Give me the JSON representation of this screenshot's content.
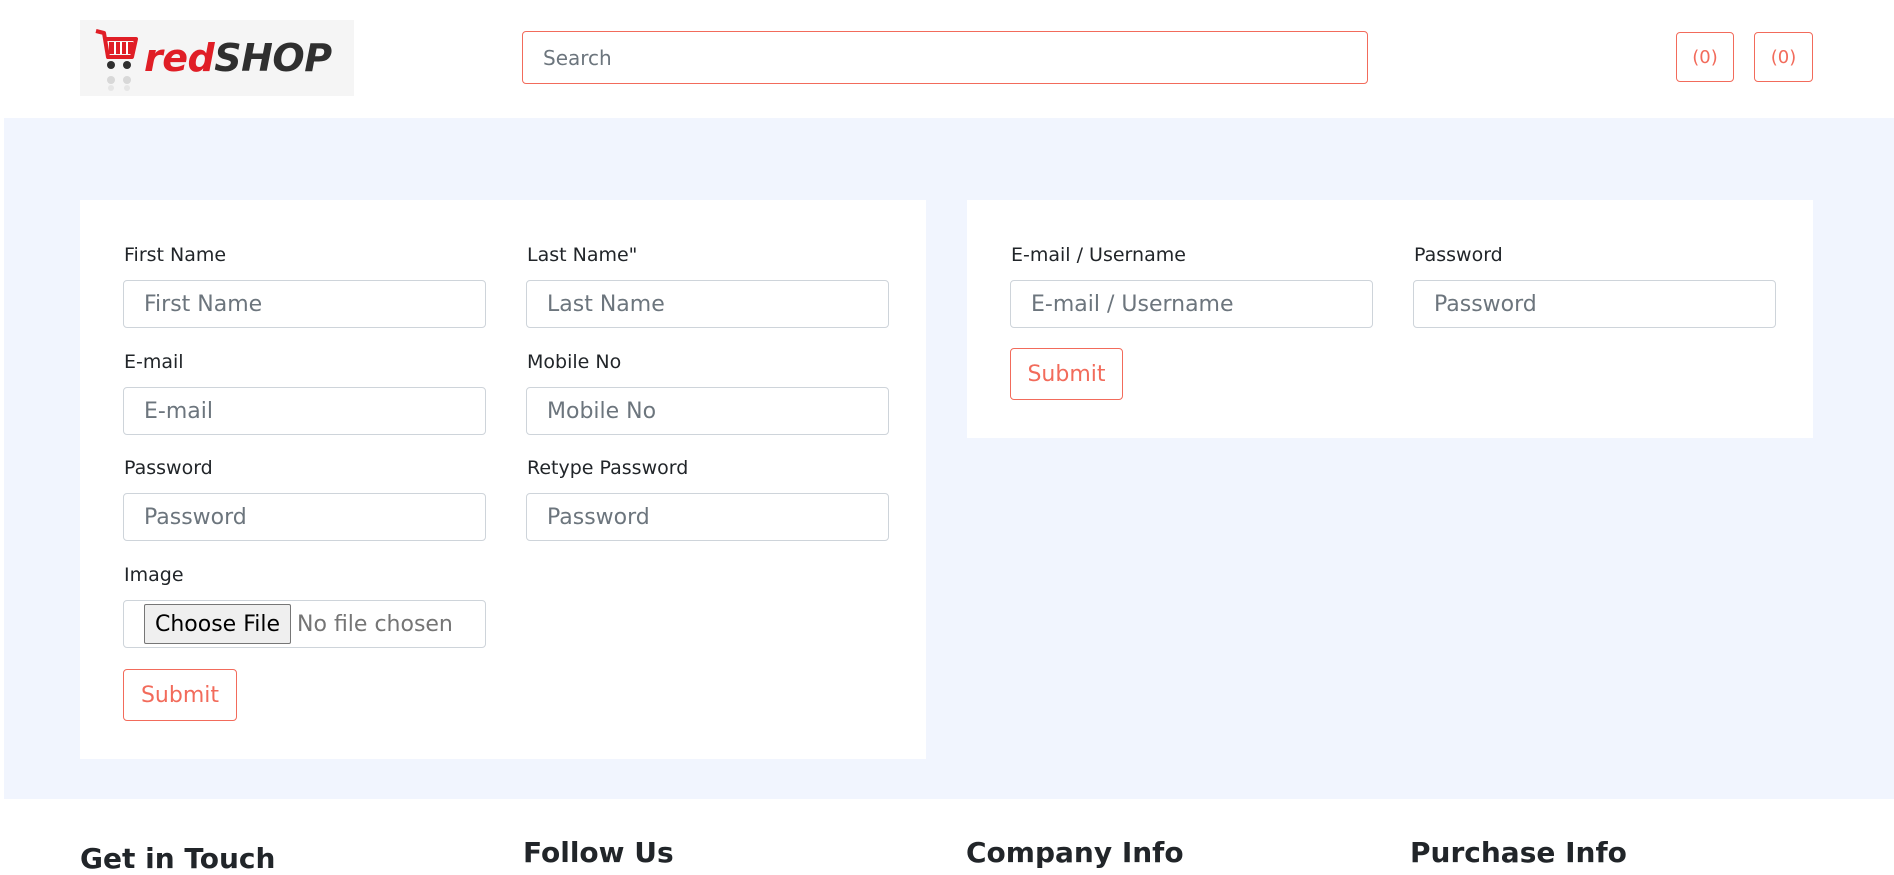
{
  "header": {
    "logo": {
      "text_red": "red",
      "text_dark": "SHOP"
    },
    "search": {
      "placeholder": "Search",
      "value": ""
    },
    "cart_count": "(0)",
    "wishlist_count": "(0)"
  },
  "register_form": {
    "first_name": {
      "label": "First Name",
      "placeholder": "First Name"
    },
    "last_name": {
      "label": "Last Name\"",
      "placeholder": "Last Name"
    },
    "email": {
      "label": "E-mail",
      "placeholder": "E-mail"
    },
    "mobile": {
      "label": "Mobile No",
      "placeholder": "Mobile No"
    },
    "password": {
      "label": "Password",
      "placeholder": "Password"
    },
    "retype_password": {
      "label": "Retype Password",
      "placeholder": "Password"
    },
    "image": {
      "label": "Image",
      "button": "Choose File",
      "status": "No file chosen"
    },
    "submit": "Submit"
  },
  "login_form": {
    "username": {
      "label": "E-mail / Username",
      "placeholder": "E-mail / Username"
    },
    "password": {
      "label": "Password",
      "placeholder": "Password"
    },
    "submit": "Submit"
  },
  "footer": {
    "headings": [
      "Get in Touch",
      "Follow Us",
      "Company Info",
      "Purchase Info"
    ]
  },
  "colors": {
    "accent": "#f26b5b",
    "logo_red": "#e01e26",
    "main_background": "#f1f5fe",
    "input_border": "#ced4da"
  }
}
